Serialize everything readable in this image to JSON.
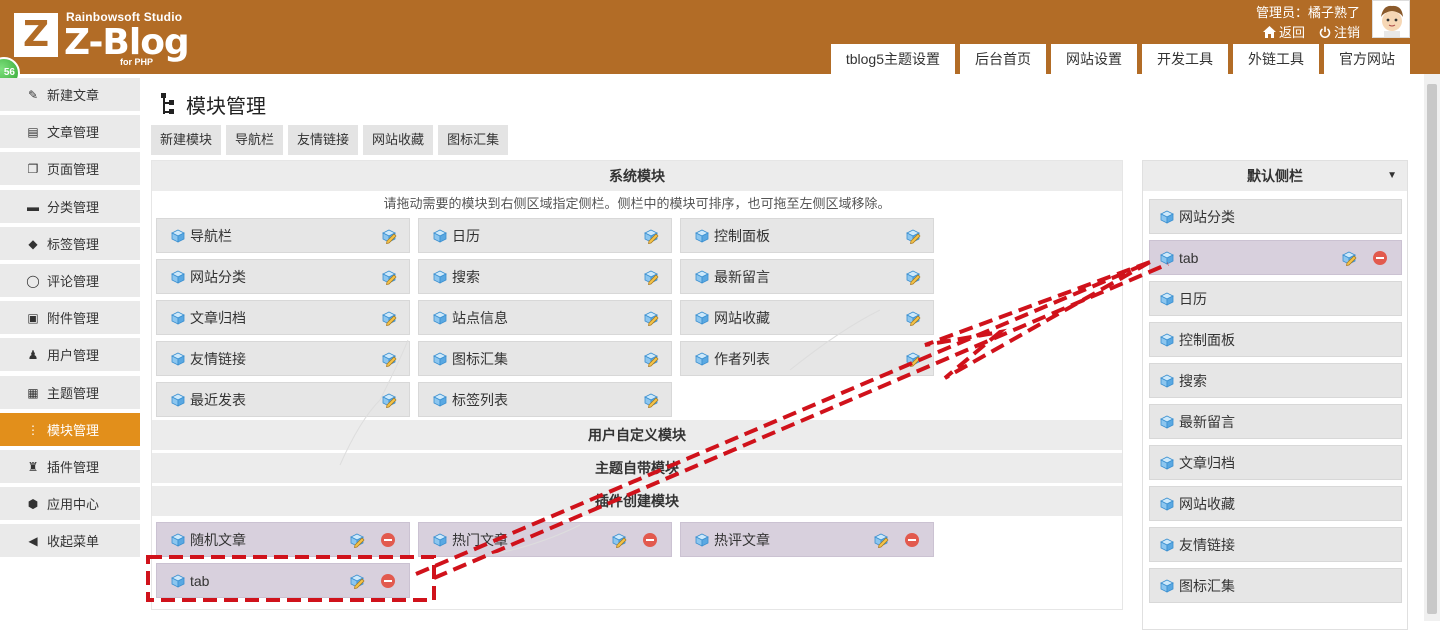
{
  "brand": {
    "studio": "Rainbowsoft Studio",
    "name": "Z-Blog",
    "sub": "for PHP",
    "logo_letter": "Z"
  },
  "badge": "56",
  "admin": {
    "label": "管理员：橘子熟了",
    "back": "返回",
    "logout": "注销"
  },
  "topnav": [
    "tblog5主题设置",
    "后台首页",
    "网站设置",
    "开发工具",
    "外链工具",
    "官方网站"
  ],
  "sidebar": [
    {
      "label": "新建文章",
      "icon": "edit-icon"
    },
    {
      "label": "文章管理",
      "icon": "article-icon"
    },
    {
      "label": "页面管理",
      "icon": "pages-icon"
    },
    {
      "label": "分类管理",
      "icon": "folder-icon"
    },
    {
      "label": "标签管理",
      "icon": "tag-icon"
    },
    {
      "label": "评论管理",
      "icon": "comment-icon"
    },
    {
      "label": "附件管理",
      "icon": "attachment-icon"
    },
    {
      "label": "用户管理",
      "icon": "user-icon"
    },
    {
      "label": "主题管理",
      "icon": "theme-icon"
    },
    {
      "label": "模块管理",
      "icon": "module-icon"
    },
    {
      "label": "插件管理",
      "icon": "plugin-icon"
    },
    {
      "label": "应用中心",
      "icon": "app-center-icon"
    },
    {
      "label": "收起菜单",
      "icon": "collapse-icon"
    }
  ],
  "page_title": "模块管理",
  "subtabs": [
    "新建模块",
    "导航栏",
    "友情链接",
    "网站收藏",
    "图标汇集"
  ],
  "sections": {
    "system": "系统模块",
    "hint": "请拖动需要的模块到右侧区域指定侧栏。侧栏中的模块可排序，也可拖至左侧区域移除。",
    "custom": "用户自定义模块",
    "theme": "主题自带模块",
    "plugin": "插件创建模块"
  },
  "system_modules": [
    "导航栏",
    "日历",
    "控制面板",
    "网站分类",
    "搜索",
    "最新留言",
    "文章归档",
    "站点信息",
    "网站收藏",
    "友情链接",
    "图标汇集",
    "作者列表",
    "最近发表",
    "标签列表"
  ],
  "plugin_modules": [
    "随机文章",
    "热门文章",
    "热评文章",
    "tab"
  ],
  "default_sidebar": {
    "title": "默认侧栏",
    "items": [
      "网站分类",
      "tab",
      "日历",
      "控制面板",
      "搜索",
      "最新留言",
      "文章归档",
      "网站收藏",
      "友情链接",
      "图标汇集"
    ]
  },
  "colors": {
    "header": "#b26c26",
    "active_menu": "#e28f1b",
    "annotation": "#d0121b",
    "module_plugin": "#d8d0dd"
  }
}
